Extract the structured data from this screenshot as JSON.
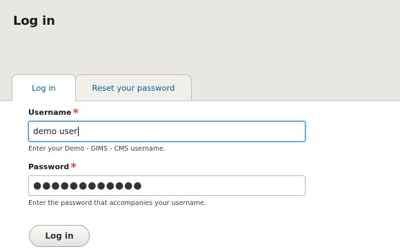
{
  "page": {
    "title": "Log in"
  },
  "tabs": [
    {
      "label": "Log in",
      "active": true
    },
    {
      "label": "Reset your password",
      "active": false
    }
  ],
  "form": {
    "username": {
      "label": "Username",
      "required_marker": "*",
      "value": "demo user",
      "description": "Enter your Demo - GIMS - CMS username."
    },
    "password": {
      "label": "Password",
      "required_marker": "*",
      "value": "●●●●●●●●●●●●",
      "description": "Enter the password that accompanies your username."
    },
    "submit_label": "Log in"
  },
  "colors": {
    "header_bg": "#e8e7e2",
    "tab_link": "#0b5d98",
    "required": "#e4412b",
    "focus_border": "#3c8fd1"
  }
}
